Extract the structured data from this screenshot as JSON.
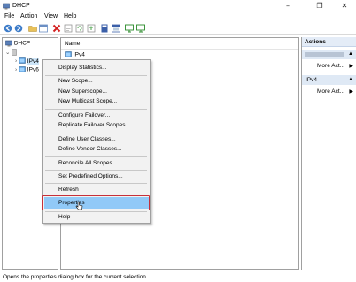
{
  "window": {
    "title": "DHCP"
  },
  "menubar": {
    "file": "File",
    "action": "Action",
    "view": "View",
    "help": "Help"
  },
  "tree": {
    "root": "DHCP",
    "server": "",
    "ipv4": "IPv4",
    "ipv6": "IPv6"
  },
  "center": {
    "column_name": "Name",
    "item": "IPv4"
  },
  "actions": {
    "title": "Actions",
    "section1_label": "",
    "section2_label": "IPv4",
    "more_actions": "More Act...",
    "more_actions2": "More Act..."
  },
  "context_menu": {
    "display_statistics": "Display Statistics...",
    "new_scope": "New Scope...",
    "new_superscope": "New Superscope...",
    "new_multicast_scope": "New Multicast Scope...",
    "configure_failover": "Configure Failover...",
    "replicate_failover": "Replicate Failover Scopes...",
    "define_user_classes": "Define User Classes...",
    "define_vendor_classes": "Define Vendor Classes...",
    "reconcile_all_scopes": "Reconcile All Scopes...",
    "set_predefined_options": "Set Predefined Options...",
    "refresh": "Refresh",
    "properties": "Properties",
    "help": "Help"
  },
  "status": {
    "text": "Opens the properties dialog box for the current selection."
  },
  "colors": {
    "highlight": "#91c9f7",
    "annotation_box": "#c5303a",
    "actions_header": "#e4ecf7"
  },
  "icons": [
    "dhcp-app-icon",
    "back-icon",
    "forward-icon",
    "folder-icon",
    "console-tree-icon",
    "delete-icon",
    "properties-icon",
    "refresh-icon",
    "export-icon",
    "help-icon",
    "monitor-icon",
    "cursor-icon"
  ]
}
